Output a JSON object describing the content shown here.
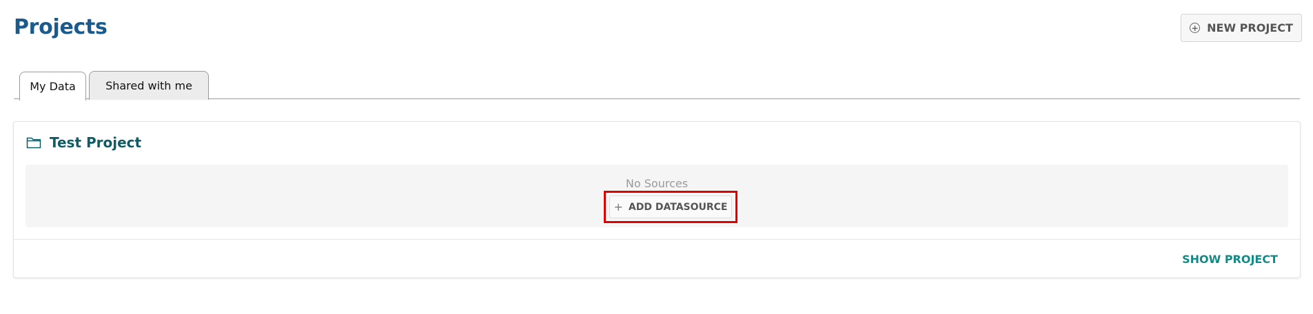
{
  "header": {
    "title": "Projects",
    "new_project_label": "NEW PROJECT"
  },
  "tabs": [
    {
      "label": "My Data",
      "active": true
    },
    {
      "label": "Shared with me",
      "active": false
    }
  ],
  "project": {
    "name": "Test Project",
    "empty_text": "No Sources",
    "add_datasource_label": "ADD DATASOURCE",
    "show_project_label": "SHOW PROJECT"
  },
  "icons": {
    "new_project": "plus-circle-icon",
    "folder": "folder-icon",
    "add": "plus-icon"
  },
  "colors": {
    "title": "#1a5a8c",
    "project_title": "#0f5c66",
    "accent": "#128a86",
    "highlight": "#e00000"
  }
}
